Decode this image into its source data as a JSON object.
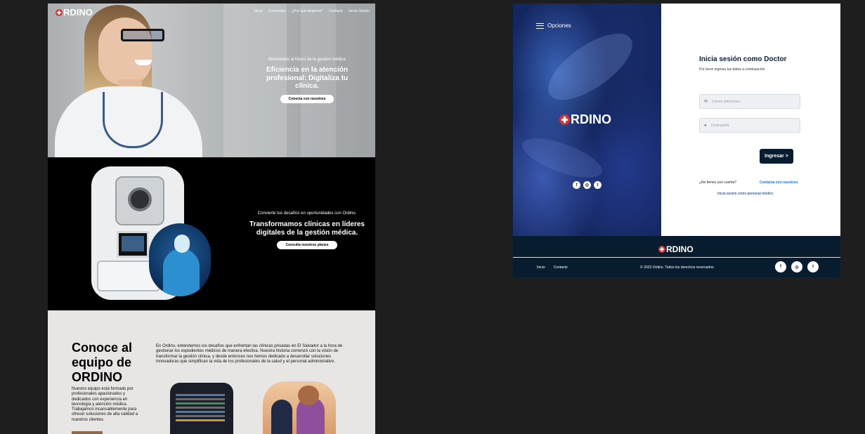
{
  "landing": {
    "nav": {
      "logo_text": "RDINO",
      "links": [
        "Inicio",
        "Conócenos",
        "¿Por qué elegirnos?",
        "Contacto",
        "Iniciar Sesión"
      ]
    },
    "hero": {
      "kicker": "Bienvenido al futuro de la gestión médica",
      "headline": "Eficiencia en la atención profesional: Digitaliza tu clínica.",
      "cta": "Conecta con nosotros"
    },
    "transform": {
      "kicker": "Convierte tus desafíos en oportunidades con Ordino.",
      "headline": "Transformamos clínicas en líderes digitales de la gestión médica.",
      "cta": "Consulta nuestros planes"
    },
    "team": {
      "title": "Conoce al equipo de ORDINO",
      "subtitle": "Nuestro equipo está formado por profesionales apasionados y dedicados con experiencia en tecnología y atención médica. Trabajamos incansablemente para ofrecer soluciones de alta calidad a nuestros clientes.",
      "body": "En Ordino, entendemos los desafíos que enfrentan las clínicas privadas en El Salvador a la hora de gestionar los expedientes médicos de manera efectiva. Nuestra historia comenzó con la visión de transformar la gestión clínica, y desde entonces nos hemos dedicado a desarrollar soluciones innovadoras que simplifican la vida de los profesionales de la salud y el personal administrativo."
    }
  },
  "login_page": {
    "menu_label": "Opciones",
    "logo_text": "RDINO",
    "social_icons": [
      "f",
      "◎",
      "t"
    ],
    "title": "Inicia sesión como Doctor",
    "hint": "Por favor ingresa tus datos a continuación",
    "email_placeholder": "Correo electrónico",
    "password_placeholder": "Contraseña",
    "submit": "Ingresar >",
    "no_account": "¿No tienes  uno cuenta?",
    "contact_link": "Contacta con nosotros",
    "staff_link": "Inicia sesión como personal médico",
    "footer": {
      "logo_text": "RDINO",
      "links": [
        "Inicio",
        "Contacto"
      ],
      "copyright": "© 2023 Ordino. Todos los derechos reservados.",
      "social_icons": [
        "f",
        "◎",
        "t"
      ]
    }
  },
  "colors": {
    "canvas_bg": "#1e1e1e",
    "brand_red": "#e03131",
    "navy": "#071c2e",
    "link_blue": "#1a73e8"
  }
}
